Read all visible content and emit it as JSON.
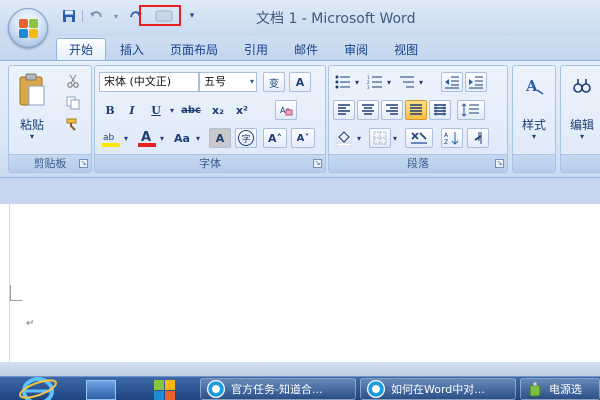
{
  "window": {
    "title": "文档 1 - Microsoft Word"
  },
  "qat": {
    "customize_glyph": "▾"
  },
  "tabs": [
    {
      "label": "开始",
      "active": true
    },
    {
      "label": "插入"
    },
    {
      "label": "页面布局"
    },
    {
      "label": "引用"
    },
    {
      "label": "邮件"
    },
    {
      "label": "审阅"
    },
    {
      "label": "视图"
    }
  ],
  "ribbon": {
    "clipboard": {
      "label": "剪贴板",
      "paste_label": "粘贴"
    },
    "font": {
      "label": "字体",
      "font_name": "宋体 (中文正)",
      "font_size": "五号",
      "wen_label": "变",
      "bold": "B",
      "italic": "I",
      "underline": "U",
      "strike": "abc",
      "subscript": "x₂",
      "superscript": "x²",
      "highlight": "ab",
      "color": "A",
      "change_case": "Aa",
      "char_shading": "A",
      "enclose": "字",
      "grow": "A˄",
      "shrink": "A˅"
    },
    "paragraph": {
      "label": "段落"
    },
    "styles": {
      "label": "样式"
    },
    "editing": {
      "label": "编辑"
    }
  },
  "colors": {
    "accent": "#15428b",
    "highlight_red": "#e8201f",
    "highlight_yellow": "#ffe600"
  },
  "taskbar": {
    "items": [
      {
        "label": "官方任务-知道合..."
      },
      {
        "label": "如何在Word中对..."
      },
      {
        "label": "电源选"
      }
    ]
  }
}
